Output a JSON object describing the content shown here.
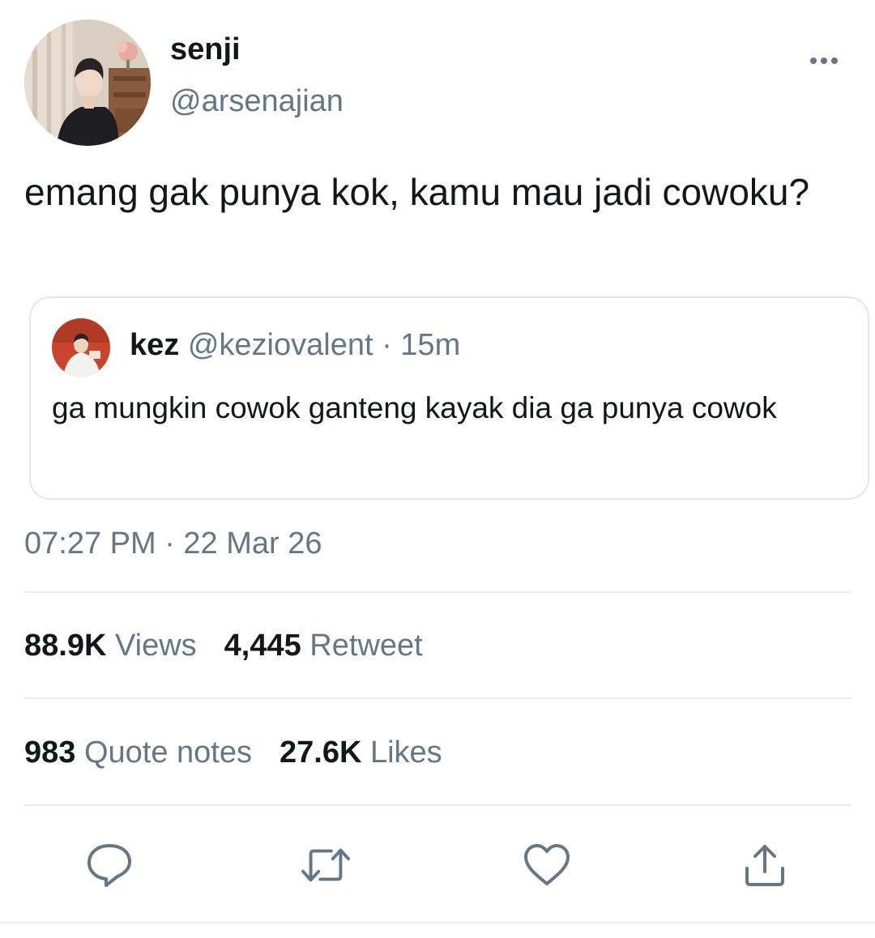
{
  "author": {
    "name": "senji",
    "handle": "@arsenajian"
  },
  "tweet": {
    "text": "emang gak punya kok, kamu mau jadi cowoku?",
    "timestamp": "07:27 PM · 22 Mar 26"
  },
  "quoted": {
    "name": "kez",
    "handle": "@keziovalent",
    "time": " · 15m",
    "text": "ga mungkin cowok ganteng kayak dia ga punya cowok"
  },
  "stats": {
    "views_count": "88.9K",
    "views_label": " Views",
    "retweet_count": "4,445",
    "retweet_label": " Retweet",
    "quote_count": "983",
    "quote_label": " Quote notes",
    "likes_count": "27.6K",
    "likes_label": " Likes"
  },
  "icons": {
    "more": "more-dots-icon",
    "reply": "reply-icon",
    "retweet": "retweet-icon",
    "like": "heart-icon",
    "share": "share-icon"
  },
  "colors": {
    "text_primary": "#14171a",
    "text_secondary": "#657786",
    "border": "#e1e8ed",
    "icon": "#657786"
  }
}
